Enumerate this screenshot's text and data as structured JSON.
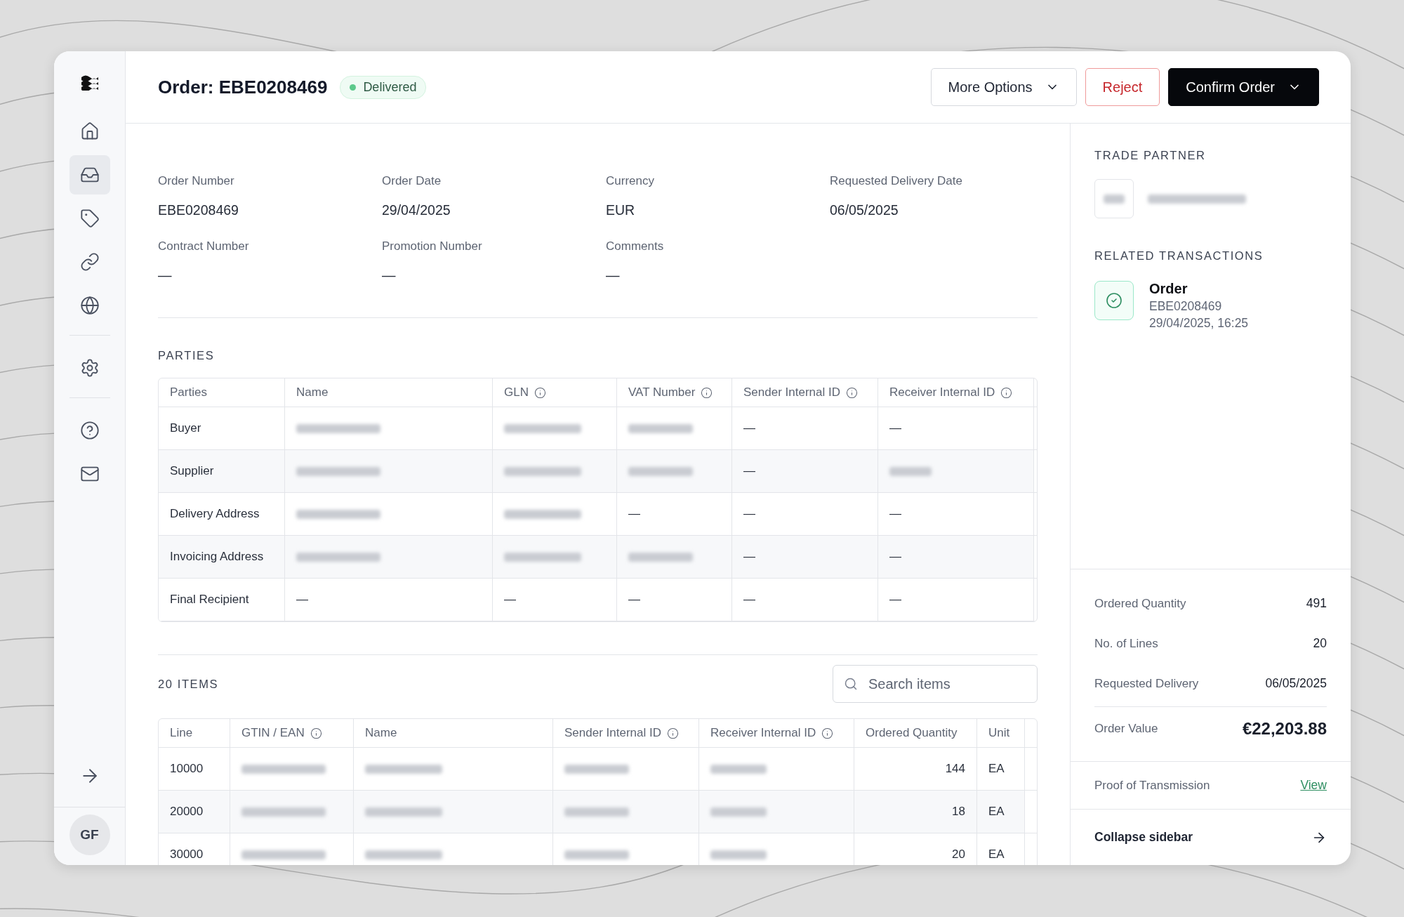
{
  "sidebar": {
    "nav": [
      {
        "selected": false
      },
      {
        "selected": true
      },
      {
        "selected": false
      },
      {
        "selected": false
      },
      {
        "selected": false
      }
    ],
    "settings": [
      {
        "selected": false
      }
    ],
    "support": [
      {
        "selected": false
      },
      {
        "selected": false
      }
    ],
    "avatar": "GF"
  },
  "header": {
    "title": "Order: EBE0208469",
    "status": "Delivered",
    "buttons": [
      {
        "kind": "outline",
        "label": "More Options",
        "menu": true
      },
      {
        "kind": "danger",
        "label": "Reject",
        "menu": false
      },
      {
        "kind": "primary",
        "label": "Confirm Order",
        "menu": true
      }
    ]
  },
  "details": [
    {
      "label": "Order Number",
      "value": "EBE0208469"
    },
    {
      "label": "Order Date",
      "value": "29/04/2025"
    },
    {
      "label": "Currency",
      "value": "EUR"
    },
    {
      "label": "Requested Delivery Date",
      "value": "06/05/2025"
    },
    {
      "label": "Contract Number",
      "value": "—"
    },
    {
      "label": "Promotion Number",
      "value": "—"
    },
    {
      "label": "Comments",
      "value": "—"
    }
  ],
  "parties": {
    "heading": "PARTIES",
    "columns": [
      {
        "label": "Parties",
        "info": false
      },
      {
        "label": "Name",
        "info": false
      },
      {
        "label": "GLN",
        "info": true
      },
      {
        "label": "VAT Number",
        "info": true
      },
      {
        "label": "Sender Internal ID",
        "info": true
      },
      {
        "label": "Receiver Internal ID",
        "info": true
      }
    ],
    "rows": [
      [
        "Buyer",
        {
          "kind": "blurred"
        },
        {
          "kind": "blurred"
        },
        {
          "kind": "blurred"
        },
        "—",
        "—"
      ],
      [
        "Supplier",
        {
          "kind": "blurred"
        },
        {
          "kind": "blurred"
        },
        {
          "kind": "blurred"
        },
        "—",
        {
          "kind": "blurred"
        }
      ],
      [
        "Delivery Address",
        {
          "kind": "blurred"
        },
        {
          "kind": "blurred"
        },
        "—",
        "—",
        "—"
      ],
      [
        "Invoicing Address",
        {
          "kind": "blurred"
        },
        {
          "kind": "blurred"
        },
        {
          "kind": "blurred"
        },
        "—",
        "—"
      ],
      [
        "Final Recipient",
        "—",
        "—",
        "—",
        "—",
        "—"
      ]
    ]
  },
  "items": {
    "heading": "20 ITEMS",
    "search": {
      "placeholder": "Search items"
    },
    "columns": [
      {
        "label": "Line",
        "info": false
      },
      {
        "label": "GTIN / EAN",
        "info": true
      },
      {
        "label": "Name",
        "info": false
      },
      {
        "label": "Sender Internal ID",
        "info": true
      },
      {
        "label": "Receiver Internal ID",
        "info": true
      },
      {
        "label": "Ordered Quantity",
        "info": false
      },
      {
        "label": "Unit",
        "info": false
      }
    ],
    "rows": [
      [
        "10000",
        {
          "kind": "blurred"
        },
        {
          "kind": "blurred"
        },
        {
          "kind": "blurred"
        },
        {
          "kind": "blurred"
        },
        "144",
        "EA"
      ],
      [
        "20000",
        {
          "kind": "blurred"
        },
        {
          "kind": "blurred"
        },
        {
          "kind": "blurred"
        },
        {
          "kind": "blurred"
        },
        "18",
        "EA"
      ],
      [
        "30000",
        {
          "kind": "blurred"
        },
        {
          "kind": "blurred"
        },
        {
          "kind": "blurred"
        },
        {
          "kind": "blurred"
        },
        "20",
        "EA"
      ]
    ]
  },
  "panel": {
    "trade_partner": {
      "heading": "TRADE PARTNER",
      "logo": {
        "kind": "blurred"
      },
      "name": {
        "kind": "blurred"
      }
    },
    "related": {
      "heading": "RELATED TRANSACTIONS",
      "items": [
        {
          "title": "Order",
          "id": "EBE0208469",
          "time": "29/04/2025, 16:25"
        }
      ]
    },
    "summary": [
      {
        "kind": "plain",
        "label": "Ordered Quantity",
        "value": "491"
      },
      {
        "kind": "plain",
        "label": "No. of Lines",
        "value": "20"
      },
      {
        "kind": "plain",
        "label": "Requested Delivery",
        "value": "06/05/2025"
      },
      {
        "kind": "total",
        "label": "Order Value",
        "value": "€22,203.88"
      }
    ],
    "proof": {
      "label": "Proof of Transmission",
      "link": "View"
    },
    "collapse": "Collapse sidebar"
  }
}
